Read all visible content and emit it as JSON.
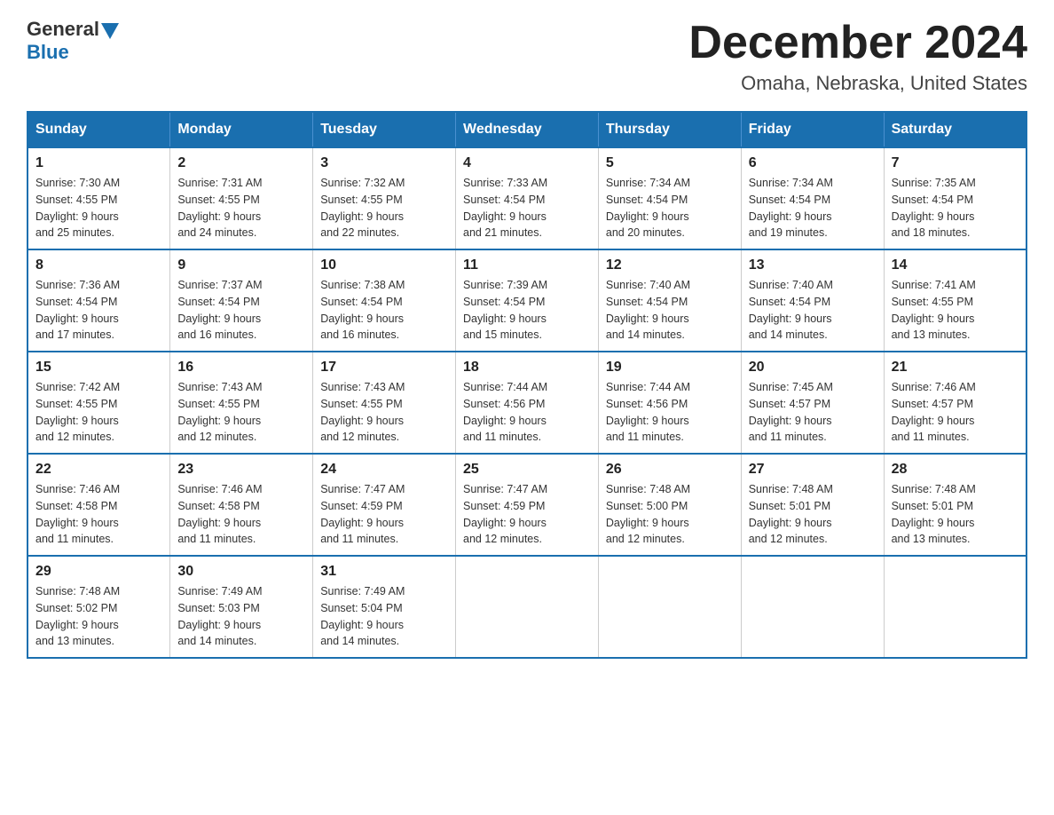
{
  "header": {
    "logo": {
      "general": "General",
      "blue": "Blue"
    },
    "title": "December 2024",
    "subtitle": "Omaha, Nebraska, United States"
  },
  "calendar": {
    "days_of_week": [
      "Sunday",
      "Monday",
      "Tuesday",
      "Wednesday",
      "Thursday",
      "Friday",
      "Saturday"
    ],
    "weeks": [
      [
        {
          "day": "1",
          "sunrise": "7:30 AM",
          "sunset": "4:55 PM",
          "daylight": "9 hours and 25 minutes."
        },
        {
          "day": "2",
          "sunrise": "7:31 AM",
          "sunset": "4:55 PM",
          "daylight": "9 hours and 24 minutes."
        },
        {
          "day": "3",
          "sunrise": "7:32 AM",
          "sunset": "4:55 PM",
          "daylight": "9 hours and 22 minutes."
        },
        {
          "day": "4",
          "sunrise": "7:33 AM",
          "sunset": "4:54 PM",
          "daylight": "9 hours and 21 minutes."
        },
        {
          "day": "5",
          "sunrise": "7:34 AM",
          "sunset": "4:54 PM",
          "daylight": "9 hours and 20 minutes."
        },
        {
          "day": "6",
          "sunrise": "7:34 AM",
          "sunset": "4:54 PM",
          "daylight": "9 hours and 19 minutes."
        },
        {
          "day": "7",
          "sunrise": "7:35 AM",
          "sunset": "4:54 PM",
          "daylight": "9 hours and 18 minutes."
        }
      ],
      [
        {
          "day": "8",
          "sunrise": "7:36 AM",
          "sunset": "4:54 PM",
          "daylight": "9 hours and 17 minutes."
        },
        {
          "day": "9",
          "sunrise": "7:37 AM",
          "sunset": "4:54 PM",
          "daylight": "9 hours and 16 minutes."
        },
        {
          "day": "10",
          "sunrise": "7:38 AM",
          "sunset": "4:54 PM",
          "daylight": "9 hours and 16 minutes."
        },
        {
          "day": "11",
          "sunrise": "7:39 AM",
          "sunset": "4:54 PM",
          "daylight": "9 hours and 15 minutes."
        },
        {
          "day": "12",
          "sunrise": "7:40 AM",
          "sunset": "4:54 PM",
          "daylight": "9 hours and 14 minutes."
        },
        {
          "day": "13",
          "sunrise": "7:40 AM",
          "sunset": "4:54 PM",
          "daylight": "9 hours and 14 minutes."
        },
        {
          "day": "14",
          "sunrise": "7:41 AM",
          "sunset": "4:55 PM",
          "daylight": "9 hours and 13 minutes."
        }
      ],
      [
        {
          "day": "15",
          "sunrise": "7:42 AM",
          "sunset": "4:55 PM",
          "daylight": "9 hours and 12 minutes."
        },
        {
          "day": "16",
          "sunrise": "7:43 AM",
          "sunset": "4:55 PM",
          "daylight": "9 hours and 12 minutes."
        },
        {
          "day": "17",
          "sunrise": "7:43 AM",
          "sunset": "4:55 PM",
          "daylight": "9 hours and 12 minutes."
        },
        {
          "day": "18",
          "sunrise": "7:44 AM",
          "sunset": "4:56 PM",
          "daylight": "9 hours and 11 minutes."
        },
        {
          "day": "19",
          "sunrise": "7:44 AM",
          "sunset": "4:56 PM",
          "daylight": "9 hours and 11 minutes."
        },
        {
          "day": "20",
          "sunrise": "7:45 AM",
          "sunset": "4:57 PM",
          "daylight": "9 hours and 11 minutes."
        },
        {
          "day": "21",
          "sunrise": "7:46 AM",
          "sunset": "4:57 PM",
          "daylight": "9 hours and 11 minutes."
        }
      ],
      [
        {
          "day": "22",
          "sunrise": "7:46 AM",
          "sunset": "4:58 PM",
          "daylight": "9 hours and 11 minutes."
        },
        {
          "day": "23",
          "sunrise": "7:46 AM",
          "sunset": "4:58 PM",
          "daylight": "9 hours and 11 minutes."
        },
        {
          "day": "24",
          "sunrise": "7:47 AM",
          "sunset": "4:59 PM",
          "daylight": "9 hours and 11 minutes."
        },
        {
          "day": "25",
          "sunrise": "7:47 AM",
          "sunset": "4:59 PM",
          "daylight": "9 hours and 12 minutes."
        },
        {
          "day": "26",
          "sunrise": "7:48 AM",
          "sunset": "5:00 PM",
          "daylight": "9 hours and 12 minutes."
        },
        {
          "day": "27",
          "sunrise": "7:48 AM",
          "sunset": "5:01 PM",
          "daylight": "9 hours and 12 minutes."
        },
        {
          "day": "28",
          "sunrise": "7:48 AM",
          "sunset": "5:01 PM",
          "daylight": "9 hours and 13 minutes."
        }
      ],
      [
        {
          "day": "29",
          "sunrise": "7:48 AM",
          "sunset": "5:02 PM",
          "daylight": "9 hours and 13 minutes."
        },
        {
          "day": "30",
          "sunrise": "7:49 AM",
          "sunset": "5:03 PM",
          "daylight": "9 hours and 14 minutes."
        },
        {
          "day": "31",
          "sunrise": "7:49 AM",
          "sunset": "5:04 PM",
          "daylight": "9 hours and 14 minutes."
        },
        null,
        null,
        null,
        null
      ]
    ],
    "labels": {
      "sunrise": "Sunrise:",
      "sunset": "Sunset:",
      "daylight": "Daylight:"
    }
  }
}
